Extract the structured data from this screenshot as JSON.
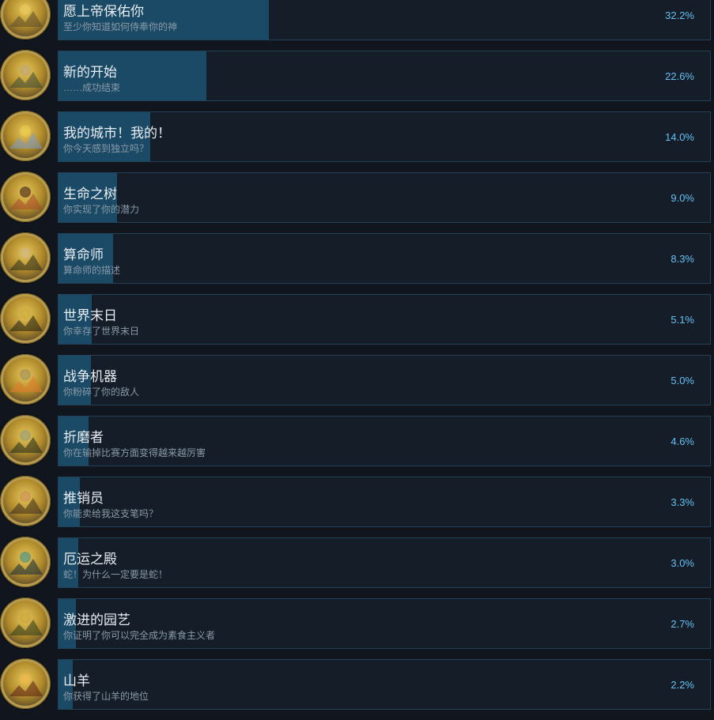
{
  "achievements": [
    {
      "title": "愿上帝保佑你",
      "description": "至少你知道如何侍奉你的神",
      "percent": "32.2%",
      "fraction": 0.322,
      "icon": "golden-temple-icon",
      "colors": [
        "#b08a2a",
        "#e7c85b",
        "#5a4a2a"
      ]
    },
    {
      "title": "新的开始",
      "description": "……成功结束",
      "percent": "22.6%",
      "fraction": 0.226,
      "icon": "pyramid-icon",
      "colors": [
        "#6b7d5a",
        "#b9a27a",
        "#3b4a3a"
      ]
    },
    {
      "title": "我的城市！我的！",
      "description": "你今天感到独立吗？",
      "percent": "14.0%",
      "fraction": 0.14,
      "icon": "golden-field-icon",
      "colors": [
        "#d8a21e",
        "#f0cc4a",
        "#7a9ac8"
      ]
    },
    {
      "title": "生命之树",
      "description": "你实现了你的潜力",
      "percent": "9.0%",
      "fraction": 0.09,
      "icon": "tree-of-life-icon",
      "colors": [
        "#7a2a1e",
        "#3d1a14",
        "#a84a2a"
      ]
    },
    {
      "title": "算命师",
      "description": "算命师的描述",
      "percent": "8.3%",
      "fraction": 0.083,
      "icon": "fortune-teller-icon",
      "colors": [
        "#5a5a3a",
        "#c9b48a",
        "#2a2a1e"
      ]
    },
    {
      "title": "世界末日",
      "description": "你幸存了世界末日",
      "percent": "5.1%",
      "fraction": 0.051,
      "icon": "doomsday-icon",
      "colors": [
        "#4a4a2a",
        "#c9a83a",
        "#1e1e14"
      ]
    },
    {
      "title": "战争机器",
      "description": "你粉碎了你的敌人",
      "percent": "5.0%",
      "fraction": 0.05,
      "icon": "war-machine-icon",
      "colors": [
        "#2a3a2a",
        "#9a8a5a",
        "#e07a2a"
      ]
    },
    {
      "title": "折磨者",
      "description": "你在输掉比赛方面变得越来越厉害",
      "percent": "4.6%",
      "fraction": 0.046,
      "icon": "tormentor-icon",
      "colors": [
        "#3a4a2a",
        "#8a9a7a",
        "#1e2a1e"
      ]
    },
    {
      "title": "推销员",
      "description": "你能卖给我这支笔吗？",
      "percent": "3.3%",
      "fraction": 0.033,
      "icon": "handshake-icon",
      "colors": [
        "#7a4a2a",
        "#c98a5a",
        "#3a2a1e"
      ]
    },
    {
      "title": "厄运之殿",
      "description": "蛇！为什么一定要是蛇！",
      "percent": "3.0%",
      "fraction": 0.03,
      "icon": "temple-of-doom-icon",
      "colors": [
        "#1e5a6a",
        "#3a8a8a",
        "#0e2a3a"
      ]
    },
    {
      "title": "激进的园艺",
      "description": "你证明了你可以完全成为素食主义者",
      "percent": "2.7%",
      "fraction": 0.027,
      "icon": "gardening-icon",
      "colors": [
        "#4a3a1e",
        "#c9a23a",
        "#2a3a1e"
      ]
    },
    {
      "title": "山羊",
      "description": "你获得了山羊的地位",
      "percent": "2.2%",
      "fraction": 0.022,
      "icon": "goat-sun-icon",
      "colors": [
        "#c96a2a",
        "#f0b24a",
        "#5a1e14"
      ]
    }
  ],
  "colors": {
    "background": "#11161e",
    "panel": "#141d28",
    "panel_border": "#234257",
    "bar": "#1b4a66",
    "percent_text": "#66c0f4",
    "icon_ring": "#b79b4f"
  }
}
